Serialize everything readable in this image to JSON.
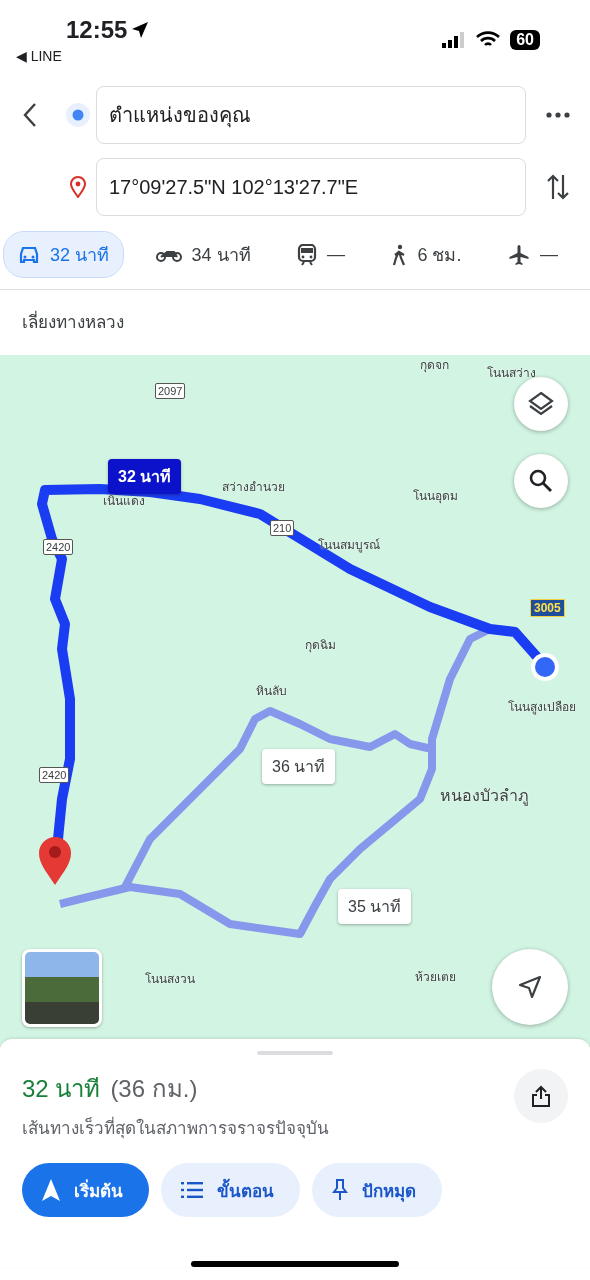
{
  "status_bar": {
    "time": "12:55",
    "back_app": "◀ LINE",
    "battery": "60"
  },
  "directions": {
    "origin": "ตำแหน่งของคุณ",
    "destination": "17°09'27.5\"N 102°13'27.7\"E"
  },
  "travel_modes": [
    {
      "kind": "car",
      "label": "32 นาที",
      "selected": true
    },
    {
      "kind": "motorbike",
      "label": "34 นาที",
      "selected": false
    },
    {
      "kind": "transit",
      "label": "—",
      "selected": false
    },
    {
      "kind": "walk",
      "label": "6 ชม.",
      "selected": false
    },
    {
      "kind": "flight",
      "label": "—",
      "selected": false
    }
  ],
  "route_note": "เลี่ยงทางหลวง",
  "map": {
    "labels": [
      {
        "kind": "place",
        "text": "กุดจก"
      },
      {
        "kind": "place",
        "text": "โนนสว่าง"
      },
      {
        "kind": "road",
        "text": "2097"
      },
      {
        "kind": "place",
        "text": "เนินแดง"
      },
      {
        "kind": "place",
        "text": "สว่างอำนวย"
      },
      {
        "kind": "place",
        "text": "โนนอุดม"
      },
      {
        "kind": "road",
        "text": "2420"
      },
      {
        "kind": "road",
        "text": "210"
      },
      {
        "kind": "place",
        "text": "โนนสมบูรณ์"
      },
      {
        "kind": "highway",
        "text": "3005"
      },
      {
        "kind": "place",
        "text": "กุดฉิม"
      },
      {
        "kind": "place",
        "text": "โนนสูงเปลือย"
      },
      {
        "kind": "place",
        "text": "หินลับ"
      },
      {
        "kind": "road",
        "text": "2420"
      },
      {
        "kind": "city",
        "text": "หนองบัวลำภู"
      },
      {
        "kind": "place",
        "text": "โนนสงวน"
      },
      {
        "kind": "place",
        "text": "ห้วยเตย"
      }
    ],
    "callouts": [
      {
        "label": "32 นาที",
        "selected": true
      },
      {
        "label": "36 นาที",
        "selected": false
      },
      {
        "label": "35 นาที",
        "selected": false
      }
    ]
  },
  "summary": {
    "duration": "32 นาที",
    "distance": "(36 กม.)",
    "description": "เส้นทางเร็วที่สุดในสภาพการจราจรปัจจุบัน"
  },
  "buttons": [
    {
      "kind": "start",
      "label": "เริ่มต้น"
    },
    {
      "kind": "steps",
      "label": "ขั้นตอน"
    },
    {
      "kind": "pin",
      "label": "ปักหมุด"
    }
  ]
}
